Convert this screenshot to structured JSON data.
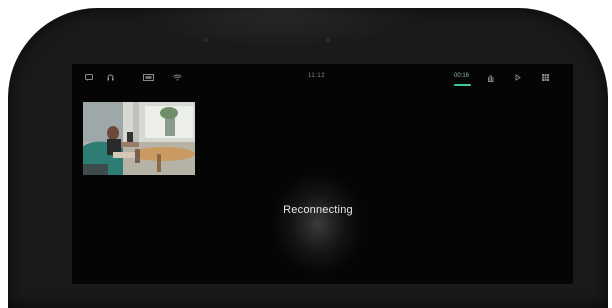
{
  "status_bar": {
    "left_icons": [
      "chat-icon",
      "headset-icon",
      "screen-share-icon",
      "wifi-icon"
    ],
    "time": "11:12",
    "active_tab": "00:16",
    "right_icons": [
      "hand-icon",
      "record-icon",
      "grid-icon"
    ],
    "accent_color": "#41c79c"
  },
  "video_thumbnail": {
    "description_icon": "participant-video-icon"
  },
  "center": {
    "status_text": "Reconnecting"
  }
}
